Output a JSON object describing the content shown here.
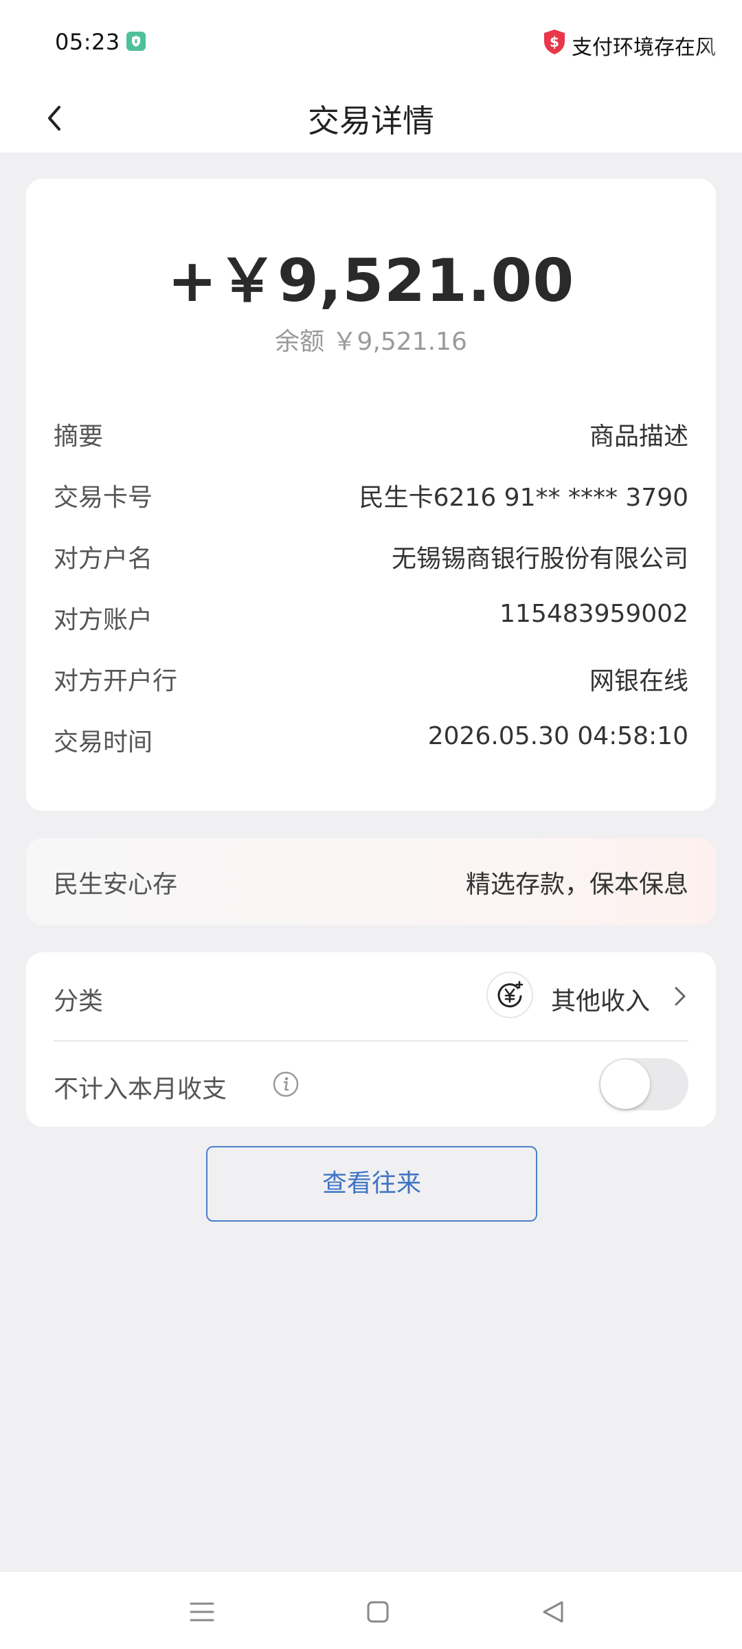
{
  "status_bar": {
    "time": "05:23",
    "warning_text": "支付环境存在风",
    "warning_color": "#e8374a"
  },
  "nav": {
    "title": "交易详情"
  },
  "transaction": {
    "amount": "+￥9,521.00",
    "balance": "余额 ￥9,521.16",
    "details": [
      {
        "label": "摘要",
        "value": "商品描述"
      },
      {
        "label": "交易卡号",
        "value": "民生卡6216 91** **** 3790"
      },
      {
        "label": "对方户名",
        "value": "无锡锡商银行股份有限公司"
      },
      {
        "label": "对方账户",
        "value": "115483959002"
      },
      {
        "label": "对方开户行",
        "value": "网银在线"
      },
      {
        "label": "交易时间",
        "value": "2026.05.30 04:58:10"
      }
    ]
  },
  "promo": {
    "label": "民生安心存",
    "value": "精选存款，保本保息"
  },
  "category": {
    "label": "分类",
    "icon": "yuan-plus-icon",
    "value": "其他收入"
  },
  "exclude": {
    "label": "不计入本月收支",
    "toggle_on": false
  },
  "actions": {
    "view_transactions": "查看往来"
  },
  "colors": {
    "accent_blue": "#3f74c4",
    "background": "#f0f0f2",
    "card": "#ffffff"
  }
}
